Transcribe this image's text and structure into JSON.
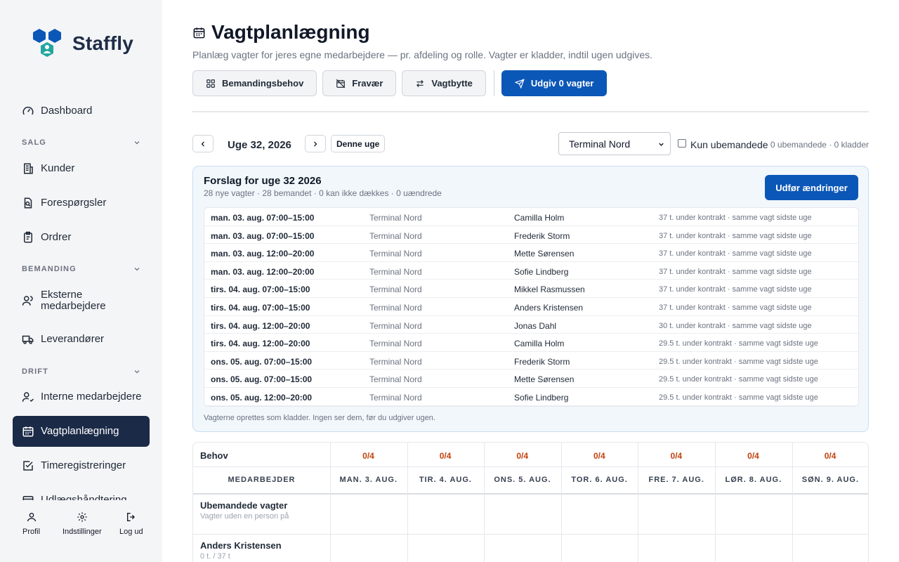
{
  "app": {
    "name": "Staffly"
  },
  "sidebar": {
    "items": {
      "dashboard": "Dashboard",
      "kunder": "Kunder",
      "forespoergsler": "Forespørgsler",
      "ordrer": "Ordrer",
      "eksterne": "Eksterne medarbejdere",
      "leverandoerer": "Leverandører",
      "interne": "Interne medarbejdere",
      "vagtplan": "Vagtplanlægning",
      "timer": "Timeregistreringer",
      "udlaeg": "Udlægshåndtering"
    },
    "sections": {
      "salg": "SALG",
      "bemanding": "BEMANDING",
      "drift": "DRIFT"
    },
    "footer": {
      "profil": "Profil",
      "indstillinger": "Indstillinger",
      "logud": "Log ud"
    }
  },
  "page": {
    "title": "Vagtplanlægning",
    "subtitle": "Planlæg vagter for jeres egne medarbejdere — pr. afdeling og rolle. Vagter er kladder, indtil ugen udgives."
  },
  "toolbar": {
    "bemandingsbehov": "Bemandingsbehov",
    "fravaer": "Fravær",
    "vagtbytte": "Vagtbytte",
    "udgiv": "Udgiv 0 vagter"
  },
  "week": {
    "label": "Uge 32, 2026",
    "today": "Denne uge",
    "site_selected": "Terminal Nord",
    "only_unstaffed": "Kun ubemandede",
    "counts": "0 ubemandede · 0 kladder"
  },
  "suggestions": {
    "title": "Forslag for uge 32 2026",
    "summary": "28 nye vagter · 28 bemandet · 0 kan ikke dækkes · 0 uændrede",
    "apply": "Udfør ændringer",
    "footnote": "Vagterne oprettes som kladder. Ingen ser dem, før du udgiver ugen.",
    "rows": [
      {
        "date": "man. 03. aug. 07:00–15:00",
        "site": "Terminal Nord",
        "name": "Camilla Holm",
        "note": "37 t. under kontrakt · samme vagt sidste uge"
      },
      {
        "date": "man. 03. aug. 07:00–15:00",
        "site": "Terminal Nord",
        "name": "Frederik Storm",
        "note": "37 t. under kontrakt · samme vagt sidste uge"
      },
      {
        "date": "man. 03. aug. 12:00–20:00",
        "site": "Terminal Nord",
        "name": "Mette Sørensen",
        "note": "37 t. under kontrakt · samme vagt sidste uge"
      },
      {
        "date": "man. 03. aug. 12:00–20:00",
        "site": "Terminal Nord",
        "name": "Sofie Lindberg",
        "note": "37 t. under kontrakt · samme vagt sidste uge"
      },
      {
        "date": "tirs. 04. aug. 07:00–15:00",
        "site": "Terminal Nord",
        "name": "Mikkel Rasmussen",
        "note": "37 t. under kontrakt · samme vagt sidste uge"
      },
      {
        "date": "tirs. 04. aug. 07:00–15:00",
        "site": "Terminal Nord",
        "name": "Anders Kristensen",
        "note": "37 t. under kontrakt · samme vagt sidste uge"
      },
      {
        "date": "tirs. 04. aug. 12:00–20:00",
        "site": "Terminal Nord",
        "name": "Jonas Dahl",
        "note": "30 t. under kontrakt · samme vagt sidste uge"
      },
      {
        "date": "tirs. 04. aug. 12:00–20:00",
        "site": "Terminal Nord",
        "name": "Camilla Holm",
        "note": "29.5 t. under kontrakt · samme vagt sidste uge"
      },
      {
        "date": "ons. 05. aug. 07:00–15:00",
        "site": "Terminal Nord",
        "name": "Frederik Storm",
        "note": "29.5 t. under kontrakt · samme vagt sidste uge"
      },
      {
        "date": "ons. 05. aug. 07:00–15:00",
        "site": "Terminal Nord",
        "name": "Mette Sørensen",
        "note": "29.5 t. under kontrakt · samme vagt sidste uge"
      },
      {
        "date": "ons. 05. aug. 12:00–20:00",
        "site": "Terminal Nord",
        "name": "Sofie Lindberg",
        "note": "29.5 t. under kontrakt · samme vagt sidste uge"
      }
    ]
  },
  "schedule": {
    "behov_label": "Behov",
    "employee_header": "MEDARBEJDER",
    "days": [
      {
        "label": "MAN. 3. AUG.",
        "need": "0/4"
      },
      {
        "label": "TIR. 4. AUG.",
        "need": "0/4"
      },
      {
        "label": "ONS. 5. AUG.",
        "need": "0/4"
      },
      {
        "label": "TOR. 6. AUG.",
        "need": "0/4"
      },
      {
        "label": "FRE. 7. AUG.",
        "need": "0/4"
      },
      {
        "label": "LØR. 8. AUG.",
        "need": "0/4"
      },
      {
        "label": "SØN. 9. AUG.",
        "need": "0/4"
      }
    ],
    "rows": [
      {
        "name": "Ubemandede vagter",
        "sub": "Vagter uden en person på"
      },
      {
        "name": "Anders Kristensen",
        "sub": "0 t. / 37 t"
      }
    ]
  },
  "colors": {
    "accent": "#0b57b7",
    "sidebar_active": "#1b2a47",
    "need_warning": "#c2410c",
    "panel_bg": "#f2f7fc"
  }
}
